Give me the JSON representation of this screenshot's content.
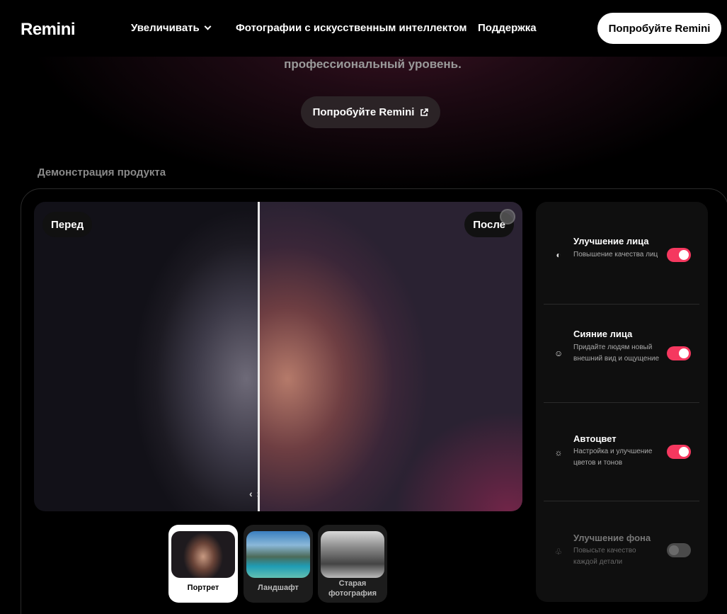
{
  "nav": {
    "logo": "Remini",
    "links": [
      "Увеличивать",
      "Фотографии с искусственным интеллектом",
      "Поддержка"
    ],
    "cta": "Попробуйте Remini"
  },
  "hero": {
    "subtitle": "профессиональный уровень.",
    "cta": "Попробуйте Remini"
  },
  "demo": {
    "section_title": "Демонстрация продукта",
    "before_label": "Перед",
    "after_label": "После",
    "handle": "‹›",
    "thumbs": [
      {
        "label": "Портрет",
        "active": true
      },
      {
        "label": "Ландшафт",
        "active": false
      },
      {
        "label": "Старая фотография",
        "active": false
      }
    ]
  },
  "settings": [
    {
      "title": "Улучшение лица",
      "desc": "Повышение качества лиц",
      "icon": "face-icon",
      "enabled": true
    },
    {
      "title": "Сияние лица",
      "desc": "Придайте людям новый внешний вид и ощущение",
      "icon": "smile-sparkle-icon",
      "enabled": true
    },
    {
      "title": "Автоцвет",
      "desc": "Настройка и улучшение цветов и тонов",
      "icon": "sun-icon",
      "enabled": true
    },
    {
      "title": "Улучшение фона",
      "desc": "Повысьте качество каждой детали",
      "icon": "trees-icon",
      "enabled": false
    }
  ],
  "colors": {
    "accent": "#f5385f",
    "background": "#000000"
  }
}
